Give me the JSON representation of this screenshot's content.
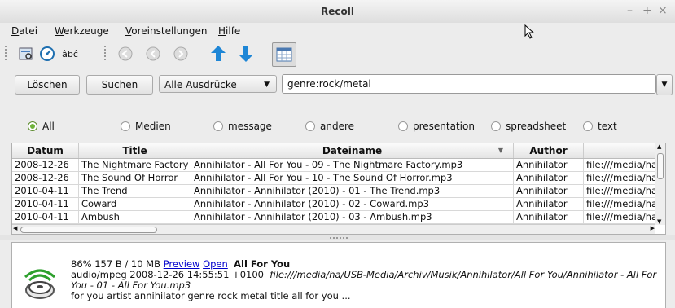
{
  "window": {
    "title": "Recoll",
    "controls": [
      "–",
      "+",
      "×"
    ]
  },
  "menu": [
    {
      "label": "Datei",
      "accel": "D",
      "rest": "atei"
    },
    {
      "label": "Werkzeuge",
      "accel": "W",
      "rest": "erkzeuge"
    },
    {
      "label": "Voreinstellungen",
      "accel": "V",
      "rest": "oreinstellungen"
    },
    {
      "label": "Hilfe",
      "accel": "H",
      "rest": "ilfe"
    }
  ],
  "toolbar": {
    "accent_label": "âbĉ",
    "icons": [
      "spell-icon",
      "history-icon",
      "accent-icon",
      "first-page-icon",
      "prev-page-icon",
      "next-page-icon",
      "sort-up-icon",
      "sort-down-icon",
      "table-view-icon"
    ]
  },
  "search": {
    "clear_label": "Löschen",
    "search_label": "Suchen",
    "mode": "Alle Ausdrücke",
    "query": "genre:rock/metal"
  },
  "filters": [
    {
      "label": "All",
      "selected": true
    },
    {
      "label": "Medien",
      "selected": false
    },
    {
      "label": "message",
      "selected": false
    },
    {
      "label": "andere",
      "selected": false
    },
    {
      "label": "presentation",
      "selected": false
    },
    {
      "label": "spreadsheet",
      "selected": false
    },
    {
      "label": "text",
      "selected": false
    }
  ],
  "results": {
    "columns": [
      "Datum",
      "Title",
      "Dateiname",
      "Author",
      ""
    ],
    "rows": [
      [
        "2008-12-26",
        "The Nightmare Factory",
        "Annihilator - All For You - 09 - The Nightmare Factory.mp3",
        "Annihilator",
        "file:///media/ha/U"
      ],
      [
        "2008-12-26",
        "The Sound Of Horror",
        "Annihilator - All For You - 10 - The Sound Of Horror.mp3",
        "Annihilator",
        "file:///media/ha/U"
      ],
      [
        "2010-04-11",
        "The Trend",
        "Annihilator - Annihilator (2010) - 01 - The Trend.mp3",
        "Annihilator",
        "file:///media/ha/U"
      ],
      [
        "2010-04-11",
        "Coward",
        "Annihilator - Annihilator (2010) - 02 - Coward.mp3",
        "Annihilator",
        "file:///media/ha/U"
      ],
      [
        "2010-04-11",
        "Ambush",
        "Annihilator - Annihilator (2010) - 03 - Ambush.mp3",
        "Annihilator",
        "file:///media/ha/U"
      ]
    ]
  },
  "detail": {
    "relevance": "86% 157 B / 10 MB",
    "preview_link": "Preview",
    "open_link": "Open",
    "title": "All For You",
    "mime": "audio/mpeg",
    "date": "2008-12-26 14:55:51 +0100",
    "url": "file:///media/ha/USB-Media/Archiv/Musik/Annihilator/All For You/Annihilator - All For You - 01 - All For You.mp3",
    "abstract": "for you artist annihilator genre rock metal title all for you ..."
  },
  "colors": {
    "accent_blue": "#1e86d6",
    "radio_selected": "#6fb33a",
    "link": "#0000cc"
  }
}
